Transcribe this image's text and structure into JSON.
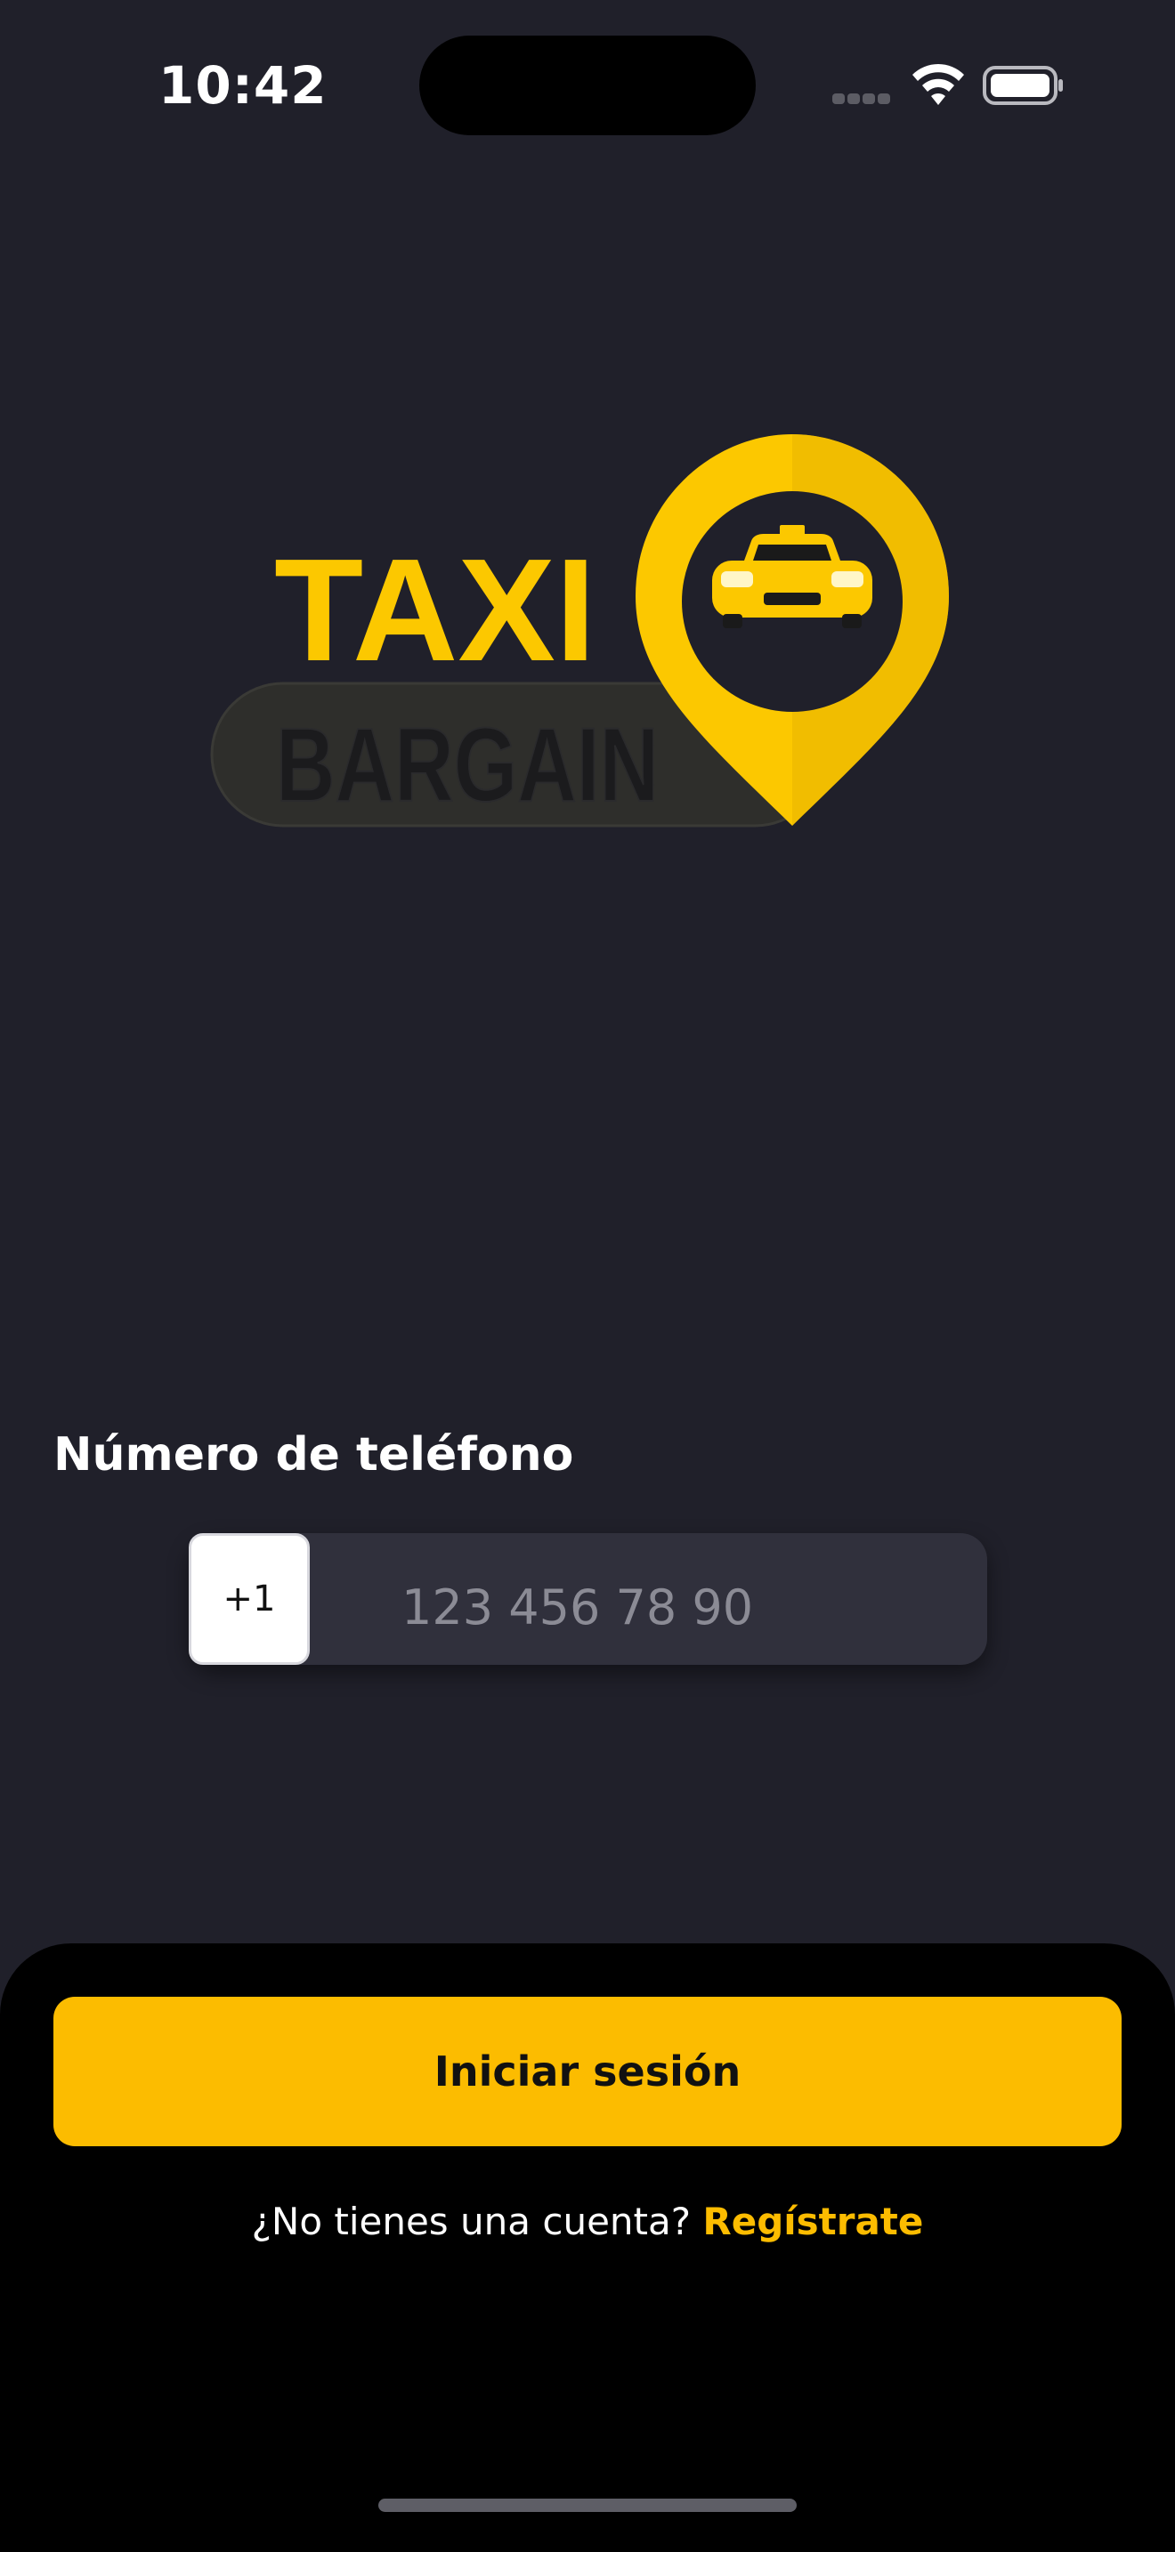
{
  "status_bar": {
    "time": "10:42"
  },
  "logo": {
    "word_top": "TAXI",
    "word_bottom": "BARGAIN"
  },
  "login_form": {
    "phone_label": "Número de teléfono",
    "country_code": "+1",
    "phone_placeholder": "123 456 78 90",
    "phone_value": ""
  },
  "actions": {
    "login_label": "Iniciar sesión",
    "signup_prompt": "¿No tienes una cuenta?",
    "signup_link": "Regístrate"
  },
  "colors": {
    "background": "#20202a",
    "accent": "#fcbc00",
    "sheet": "#000000",
    "input_bg": "#30303c"
  }
}
